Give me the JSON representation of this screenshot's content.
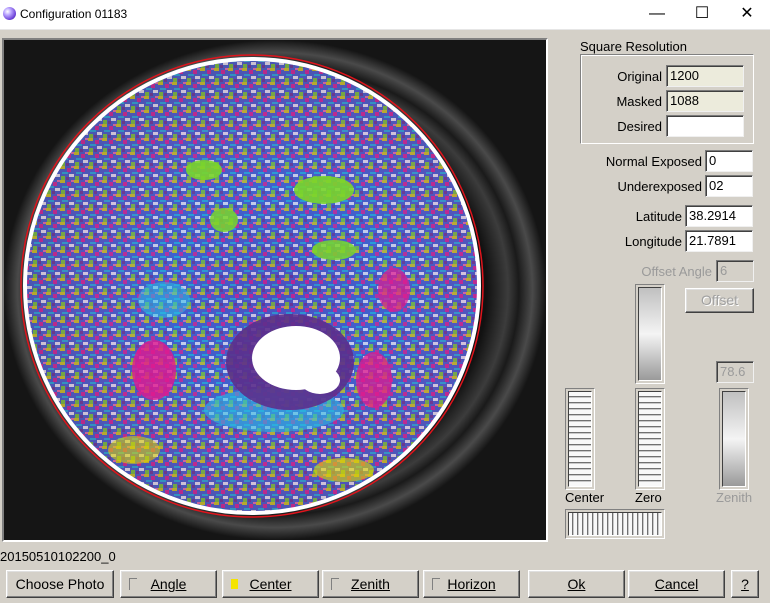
{
  "window": {
    "title": "Configuration 01183",
    "controls": {
      "minimize": "—",
      "maximize": "☐",
      "close": "✕"
    }
  },
  "photo": {
    "filename": "20150510102200_0"
  },
  "square_resolution": {
    "heading": "Square Resolution",
    "original_label": "Original",
    "original_value": "1200",
    "masked_label": "Masked",
    "masked_value": "1088",
    "desired_label": "Desired",
    "desired_value": ""
  },
  "exposure": {
    "normal_label": "Normal Exposed",
    "normal_value": "0",
    "under_label": "Underexposed",
    "under_value": "02"
  },
  "location": {
    "latitude_label": "Latitude",
    "latitude_value": "38.2914",
    "longitude_label": "Longitude",
    "longitude_value": "21.7891"
  },
  "offset": {
    "angle_label": "Offset Angle",
    "angle_value": "6",
    "button_label": "Offset"
  },
  "sliders": {
    "center_label": "Center",
    "zero_label": "Zero",
    "zenith_label": "Zenith",
    "zenith_value": "78.6"
  },
  "buttons": {
    "choose_photo": "Choose Photo",
    "angle": "Angle",
    "center": "Center",
    "zenith": "Zenith",
    "horizon": "Horizon",
    "ok": "Ok",
    "cancel": "Cancel",
    "help": "?"
  },
  "colors": {
    "toggle_on": "#f5e400",
    "dialog_bg": "#d4d0c8"
  }
}
